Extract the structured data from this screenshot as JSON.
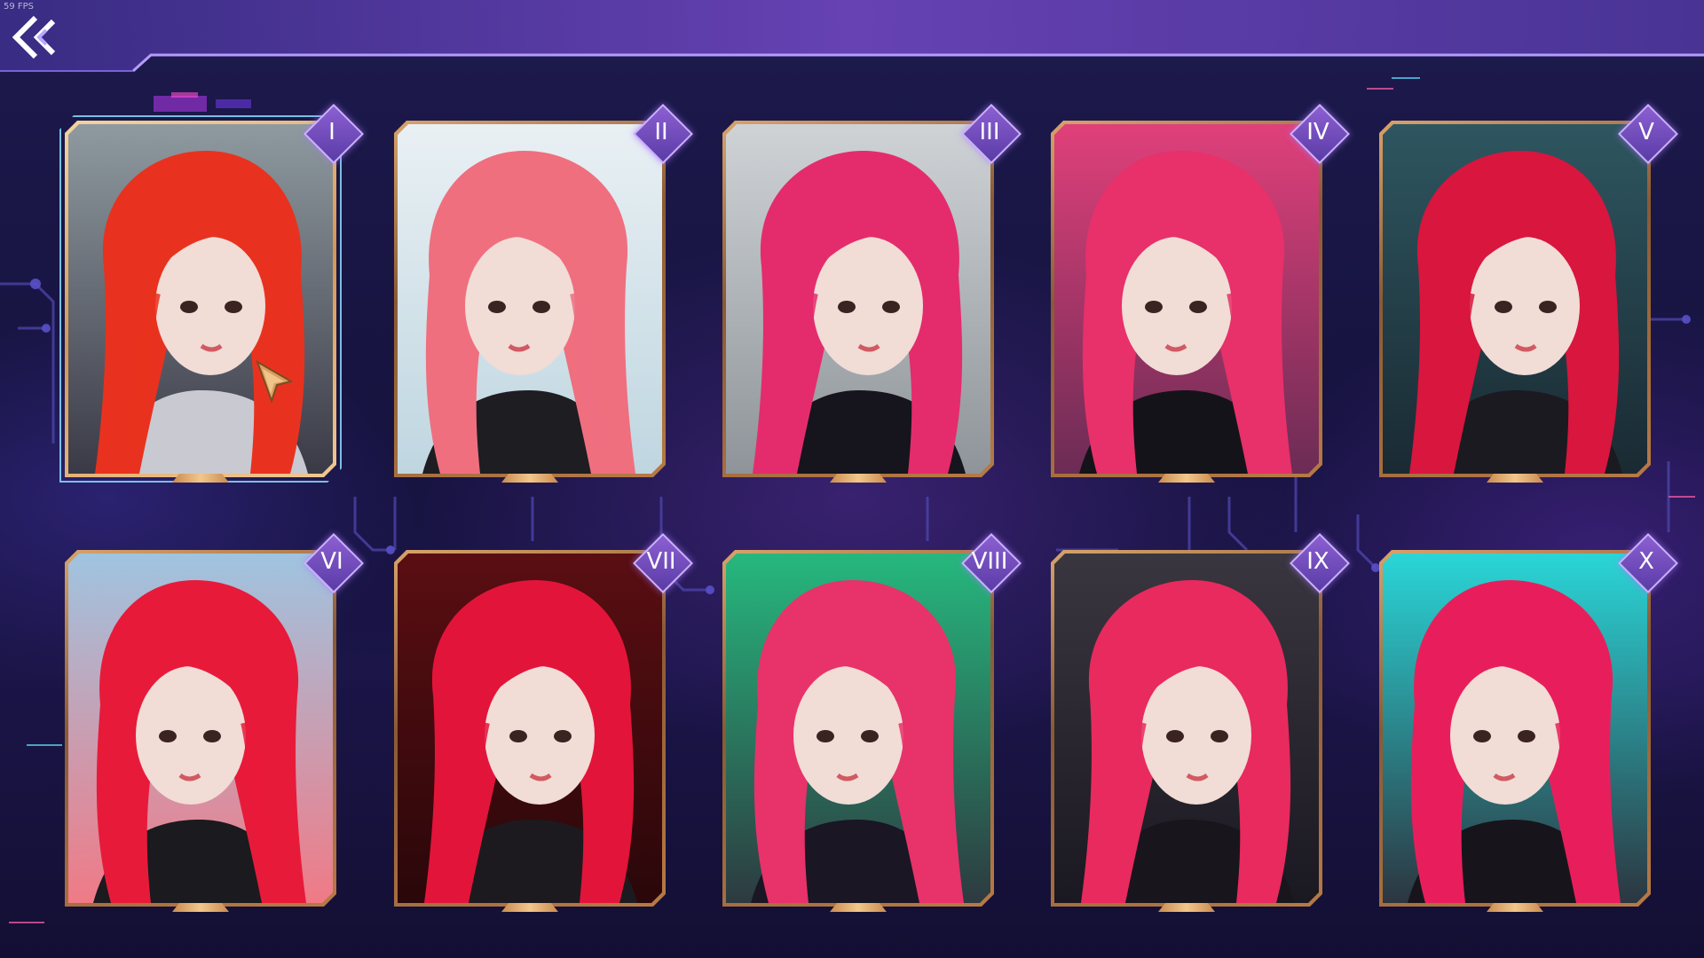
{
  "header": {
    "fps_label": "59 FPS",
    "back_icon": "double-chevron-left-icon"
  },
  "gallery": {
    "selected_index": 0,
    "cards": [
      {
        "numeral": "I",
        "hair": "#e8321f",
        "bg_top": "#8f9aa0",
        "bg_bottom": "#3a3a46",
        "outfit": "#c9c9d2"
      },
      {
        "numeral": "II",
        "hair": "#ef6f7f",
        "bg_top": "#e9f0f4",
        "bg_bottom": "#bfd6e0",
        "outfit": "#1d1d22"
      },
      {
        "numeral": "III",
        "hair": "#e42c6c",
        "bg_top": "#cfd3d6",
        "bg_bottom": "#8e9499",
        "outfit": "#16141c"
      },
      {
        "numeral": "IV",
        "hair": "#e8306a",
        "bg_top": "#e0407a",
        "bg_bottom": "#6b2c55",
        "outfit": "#15131a"
      },
      {
        "numeral": "V",
        "hair": "#d8163e",
        "bg_top": "#2e5660",
        "bg_bottom": "#1a2a33",
        "outfit": "#1b1a20"
      },
      {
        "numeral": "VI",
        "hair": "#e81a3a",
        "bg_top": "#9fc4e0",
        "bg_bottom": "#f07a86",
        "outfit": "#1a1a1f"
      },
      {
        "numeral": "VII",
        "hair": "#e3143a",
        "bg_top": "#5a0e12",
        "bg_bottom": "#2a070a",
        "outfit": "#1d1a1f"
      },
      {
        "numeral": "VIII",
        "hair": "#e8326a",
        "bg_top": "#26b87e",
        "bg_bottom": "#2d3a40",
        "outfit": "#1a1624"
      },
      {
        "numeral": "IX",
        "hair": "#e82a5e",
        "bg_top": "#3a3640",
        "bg_bottom": "#1a1820",
        "outfit": "#18151d"
      },
      {
        "numeral": "X",
        "hair": "#e81e5c",
        "bg_top": "#2ad6d8",
        "bg_bottom": "#2c3640",
        "outfit": "#17151b"
      }
    ]
  },
  "cursor": {
    "icon": "pointer-arrow-icon"
  }
}
